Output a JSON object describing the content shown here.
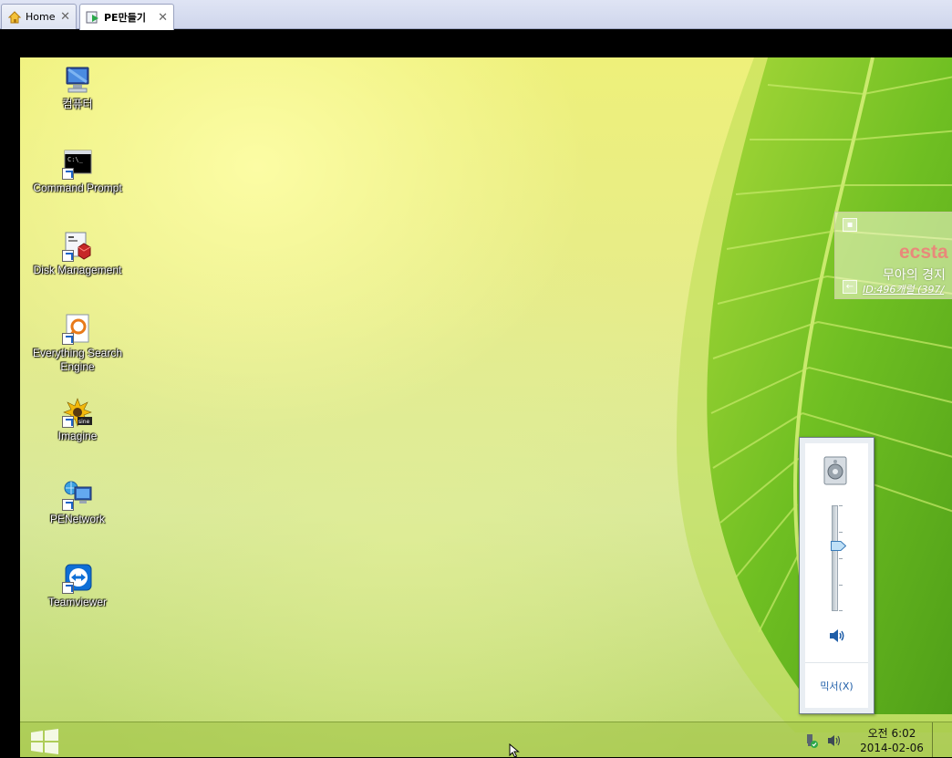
{
  "tabs": [
    {
      "label": "Home",
      "icon": "home-icon",
      "close": "✕"
    },
    {
      "label": "PE만들기",
      "icon": "vm-play-icon",
      "close": "✕",
      "active": true
    }
  ],
  "desktop": {
    "icons": [
      {
        "label": "컴퓨터",
        "icon": "computer-icon"
      },
      {
        "label": "Command Prompt",
        "icon": "command-prompt-icon"
      },
      {
        "label": "Disk Management",
        "icon": "disk-management-icon"
      },
      {
        "label": "Everything Search Engine",
        "icon": "everything-search-icon"
      },
      {
        "label": "Imagine",
        "icon": "imagine-icon"
      },
      {
        "label": "PENetwork",
        "icon": "network-icon"
      },
      {
        "label": "Teamviewer",
        "icon": "teamviewer-icon"
      }
    ]
  },
  "gadget": {
    "title": "ecsta",
    "subtitle": "무아의 경지",
    "id_line": "ID:496캐럴 (397/"
  },
  "volume_popup": {
    "level_percent": 65,
    "mixer_label": "믹서(X)"
  },
  "taskbar": {
    "clock_time": "오전 6:02",
    "clock_date": "2014-02-06"
  },
  "colors": {
    "accent": "#1f5ea8",
    "gadget_title": "#e8897a"
  }
}
